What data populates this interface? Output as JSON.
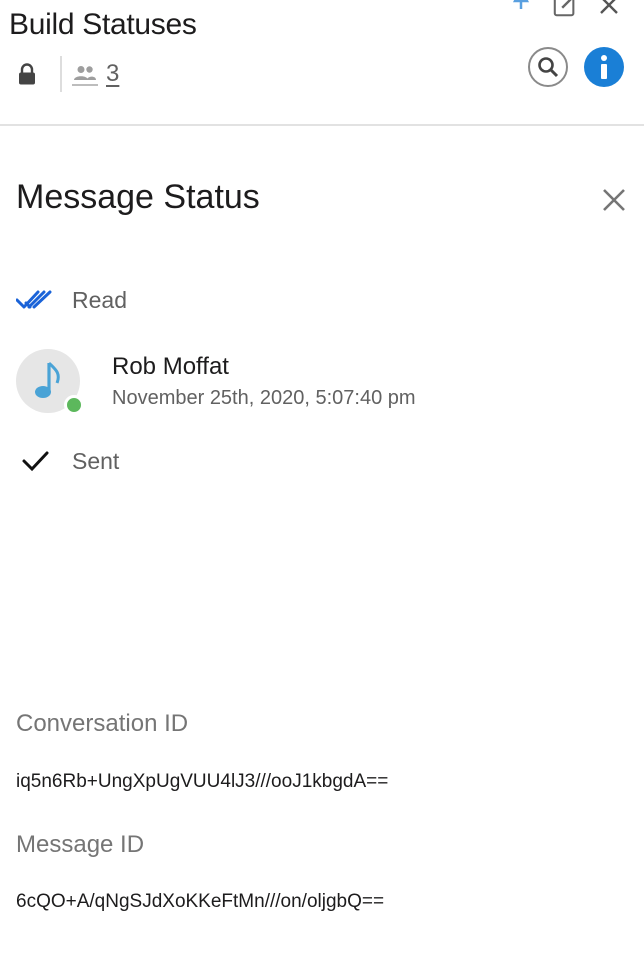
{
  "header": {
    "title": "Build Statuses",
    "member_count": "3",
    "icons": {
      "lock": "lock-icon",
      "members": "people-icon",
      "pin": "pin-icon",
      "compose": "compose-icon",
      "close": "close-icon",
      "search": "search-icon",
      "info": "info-icon"
    }
  },
  "panel": {
    "title": "Message Status",
    "read_label": "Read",
    "sent_label": "Sent",
    "reader": {
      "name": "Rob Moffat",
      "time": "November 25th, 2020, 5:07:40 pm",
      "presence": "online"
    },
    "conversation_id_label": "Conversation ID",
    "conversation_id": "iq5n6Rb+UngXpUgVUU4lJ3///ooJ1kbgdA==",
    "message_id_label": "Message ID",
    "message_id": "6cQO+A/qNgSJdXoKKeFtMn///on/oljgbQ=="
  },
  "colors": {
    "accent": "#1a7fd6",
    "read_check": "#1a63d8",
    "presence": "#5cb85c",
    "divider": "#e2e2e2"
  }
}
